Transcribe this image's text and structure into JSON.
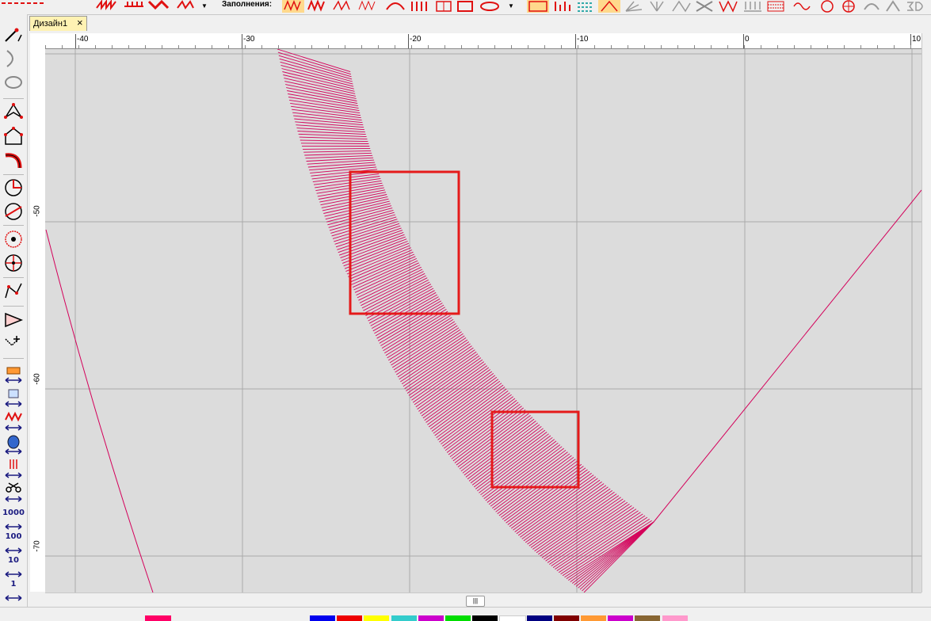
{
  "toolbar": {
    "fill_label": "Заполнения:"
  },
  "document": {
    "tab_label": "Дизайн1"
  },
  "ruler": {
    "horizontal": [
      "-40",
      "-30",
      "-20",
      "-10",
      "0",
      "10"
    ],
    "vertical": [
      "-50",
      "-60",
      "-70"
    ]
  },
  "left_toolbar": {
    "number_labels": [
      "1000",
      "100",
      "10",
      "1"
    ]
  },
  "colors": {
    "stitch": "#d4005a",
    "selection_box": "#e51a1a",
    "canvas": "#dcdcdc",
    "grid": "#aaaaaa"
  },
  "palette": {
    "active_swatch": "#ff0066",
    "colors": [
      "#0000ee",
      "#ee0000",
      "#ffff00",
      "#33cccc",
      "#cc00cc",
      "#00dd00",
      "#000000",
      "#ffffff",
      "#000080",
      "#800000",
      "#ff9933",
      "#cc00cc",
      "#886633",
      "#ff99cc"
    ]
  }
}
